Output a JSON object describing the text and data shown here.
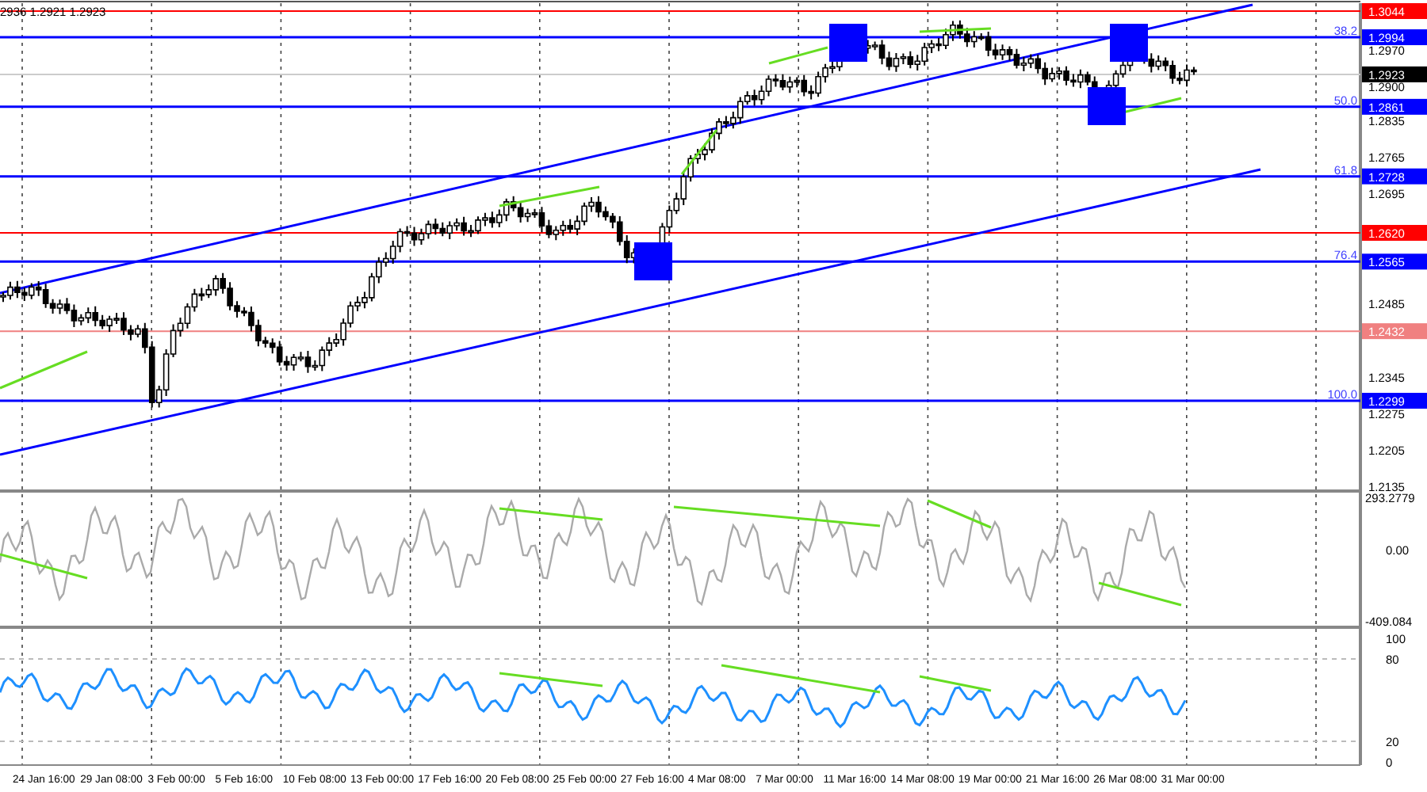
{
  "header": {
    "ohlc": "2936 1.2921 1.2923"
  },
  "price_axis": {
    "ticks": [
      "1.2970",
      "1.2900",
      "1.2835",
      "1.2765",
      "1.2695",
      "1.2485",
      "1.2345",
      "1.2275",
      "1.2205",
      "1.2135"
    ]
  },
  "levels": [
    {
      "price": "1.3044",
      "color": "#ff0000"
    },
    {
      "price": "1.2994",
      "fib": "38.2",
      "color": "#0000ff"
    },
    {
      "price": "1.2861",
      "fib": "50.0",
      "color": "#0000ff"
    },
    {
      "price": "1.2728",
      "fib": "61.8",
      "color": "#0000ff"
    },
    {
      "price": "1.2620",
      "color": "#ff0000"
    },
    {
      "price": "1.2565",
      "fib": "76.4",
      "color": "#0000ff"
    },
    {
      "price": "1.2432",
      "color": "#f08080"
    },
    {
      "price": "1.2299",
      "fib": "100.0",
      "color": "#0000ff"
    }
  ],
  "current_price": "1.2923",
  "cci_panel": {
    "max_label": "293.2779",
    "zero_label": "0.00",
    "min_label": "-409.084"
  },
  "oscillator_panel": {
    "ticks": [
      "100",
      "80",
      "20",
      "0"
    ]
  },
  "time_axis": {
    "labels": [
      "24 Jan 16:00",
      "29 Jan 08:00",
      "3 Feb 00:00",
      "5 Feb 16:00",
      "10 Feb 08:00",
      "13 Feb 00:00",
      "17 Feb 16:00",
      "20 Feb 08:00",
      "25 Feb 00:00",
      "27 Feb 16:00",
      "4 Mar 08:00",
      "7 Mar 00:00",
      "11 Mar 16:00",
      "14 Mar 08:00",
      "19 Mar 00:00",
      "21 Mar 16:00",
      "26 Mar 08:00",
      "31 Mar 00:00"
    ]
  }
}
